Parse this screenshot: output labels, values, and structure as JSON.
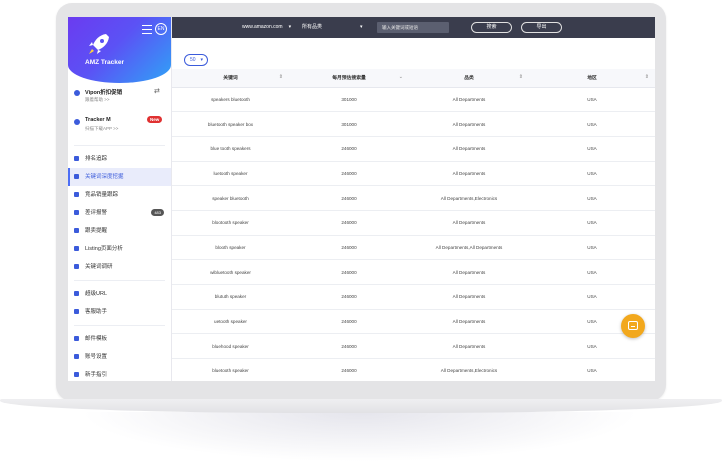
{
  "sidebar": {
    "brand": "AMZ Tracker",
    "lang": "EN",
    "promos": [
      {
        "title": "Vipon折扣促销",
        "sub": "跟着帮助 >>"
      },
      {
        "title": "Tracker M",
        "sub": "扫描下载APP >>",
        "badge": "New"
      }
    ],
    "group1": [
      {
        "label": "排名追踪",
        "icon": "bar-chart-icon"
      },
      {
        "label": "关键词深度挖掘",
        "icon": "search-icon",
        "active": true
      },
      {
        "label": "竞品销量跟踪",
        "icon": "search-icon"
      },
      {
        "label": "差评报警",
        "icon": "heart-icon",
        "count": "483"
      },
      {
        "label": "跟卖提醒",
        "icon": "list-icon"
      },
      {
        "label": "Listing页面分析",
        "icon": "eye-icon"
      },
      {
        "label": "关键词调研",
        "icon": "search-icon"
      }
    ],
    "group2": [
      {
        "label": "超级URL",
        "icon": "shuffle-icon"
      },
      {
        "label": "客服助手",
        "icon": "chat-icon"
      }
    ],
    "group3": [
      {
        "label": "邮件模板",
        "icon": "mail-icon"
      },
      {
        "label": "账号设置",
        "icon": "wrench-icon"
      },
      {
        "label": "新手指引",
        "icon": "video-icon"
      }
    ]
  },
  "topbar": {
    "domain": "www.amazon.com",
    "category": "所有品类",
    "search_placeholder": "输入关键词或短语",
    "search_button": "搜索",
    "export_button": "导出"
  },
  "table": {
    "per_page": "50",
    "columns": [
      "关键词",
      "每月预估搜索量",
      "品类",
      "地区"
    ],
    "rows": [
      [
        "speakers bluetooth",
        "301000",
        "All Departments",
        "USA"
      ],
      [
        "bluetooth speaker box",
        "301000",
        "All Departments",
        "USA"
      ],
      [
        "blue tooth speakers",
        "246000",
        "All Departments",
        "USA"
      ],
      [
        "luetooth speaker",
        "246000",
        "All Departments",
        "USA"
      ],
      [
        "speaker bluetooth",
        "246000",
        "All Departments,Electronics",
        "USA"
      ],
      [
        "blootooth speaker",
        "246000",
        "All Departments",
        "USA"
      ],
      [
        "blooth speaker",
        "246000",
        "All Departments,All Departments",
        "USA"
      ],
      [
        "wibluetooth speaker",
        "246000",
        "All Departments",
        "USA"
      ],
      [
        "blututh speaker",
        "246000",
        "All Departments",
        "USA"
      ],
      [
        "uetooth speaker",
        "246000",
        "All Departments",
        "USA"
      ],
      [
        "bluehood speaker",
        "246000",
        "All Departments",
        "USA"
      ],
      [
        "bluetooth speaker",
        "246000",
        "All Departments,Electronics",
        "USA"
      ]
    ]
  },
  "colors": {
    "accent": "#3b5bdb",
    "topbar": "#3a3d4d",
    "fab": "#f2a81d"
  }
}
